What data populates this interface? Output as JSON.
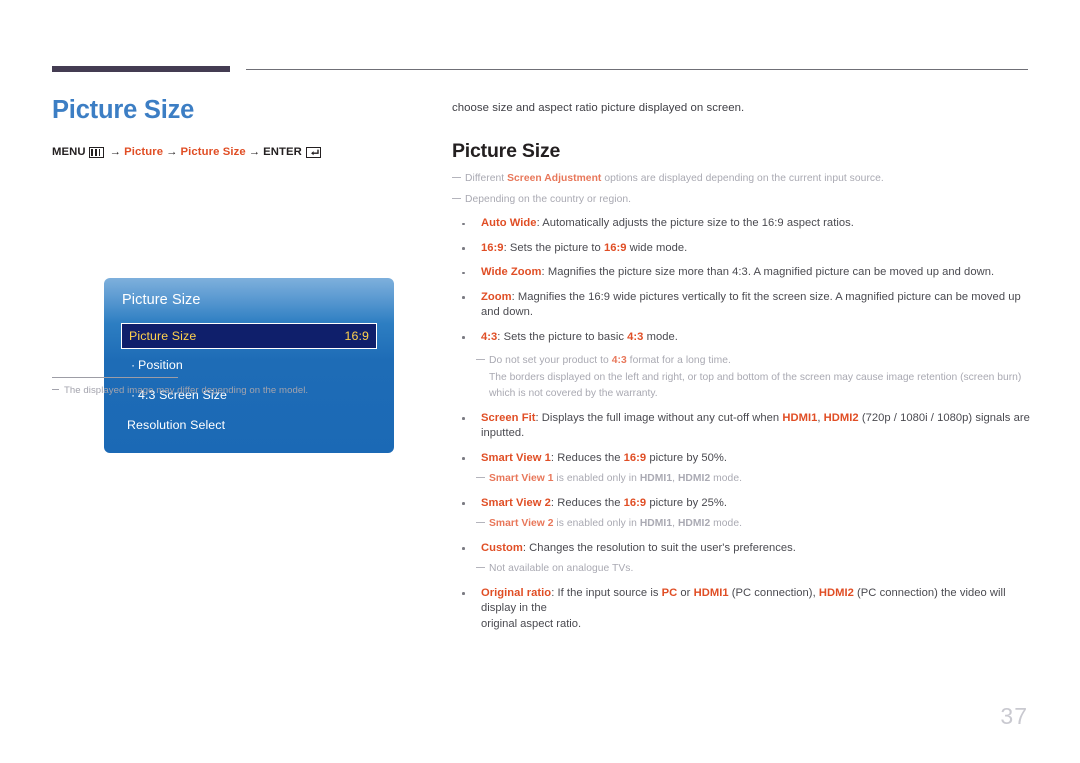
{
  "document": {
    "page_number": "37"
  },
  "left": {
    "title": "Picture Size",
    "menu_path": {
      "menu_label": "MENU",
      "menu_icon": "menu-grid-icon",
      "arrow": "→",
      "step1": "Picture",
      "step2": "Picture Size",
      "enter_label": "ENTER",
      "enter_icon": "enter-return-icon"
    },
    "osd": {
      "title": "Picture Size",
      "selected_row": {
        "label": "Picture Size",
        "value": "16:9"
      },
      "items": [
        {
          "marker": "·",
          "label": "Position"
        },
        {
          "marker": "·",
          "label": "4:3 Screen Size"
        },
        {
          "marker": "",
          "label": "Resolution Select"
        }
      ]
    },
    "footnote": "The displayed image may differ depending on the model."
  },
  "right": {
    "intro": "choose size and aspect ratio picture displayed on screen.",
    "section_title": "Picture Size",
    "notes_top": [
      {
        "pre": "Different ",
        "accent": "Screen Adjustment",
        "post": " options are displayed depending on the current input source."
      },
      {
        "pre": "Depending on the country or region.",
        "accent": "",
        "post": ""
      }
    ],
    "bullets": [
      {
        "term": "Auto Wide",
        "text": ": Automatically adjusts the picture size to the 16:9 aspect ratios."
      },
      {
        "term": "16:9",
        "text": ": Sets the picture to 16:9 wide mode.",
        "inline_accents": [
          "16:9"
        ]
      },
      {
        "term": "Wide Zoom",
        "text": ": Magnifies the picture size more than 4:3. A magnified picture can be moved up and down."
      },
      {
        "term": "Zoom",
        "text": ": Magnifies the 16:9 wide pictures vertically to fit the screen size. A magnified picture can be moved up and down."
      },
      {
        "term": "4:3",
        "text": ": Sets the picture to basic 4:3 mode.",
        "inline_accents": [
          "4:3"
        ]
      }
    ],
    "note_43": {
      "pre": "Do not set your product to ",
      "accent": "4:3",
      "post": " format for a long time.",
      "continuation_1": "The borders displayed on the left and right, or top and bottom of the screen may cause image retention (screen burn)",
      "continuation_2": "which is not covered by the warranty."
    },
    "bullets_2": [
      {
        "term": "Screen Fit",
        "parts": [
          {
            "t": ": Displays the full image without any cut-off when ",
            "style": "plain"
          },
          {
            "t": "HDMI1",
            "style": "accent"
          },
          {
            "t": ", ",
            "style": "plain"
          },
          {
            "t": "HDMI2",
            "style": "accent"
          },
          {
            "t": " (720p / 1080i / 1080p) signals are inputted.",
            "style": "plain"
          }
        ]
      },
      {
        "term": "Smart View 1",
        "parts": [
          {
            "t": ": Reduces the ",
            "style": "plain"
          },
          {
            "t": "16:9",
            "style": "accent"
          },
          {
            "t": " picture by 50%.",
            "style": "plain"
          }
        ]
      }
    ],
    "note_sv1": {
      "accent1": "Smart View 1",
      "mid": " is enabled only in ",
      "accent2": "HDMI1",
      "sep": ", ",
      "accent3": "HDMI2",
      "tail": " mode."
    },
    "bullet_sv2": {
      "term": "Smart View 2",
      "parts": [
        {
          "t": ": Reduces the ",
          "style": "plain"
        },
        {
          "t": "16:9",
          "style": "accent"
        },
        {
          "t": " picture by 25%.",
          "style": "plain"
        }
      ]
    },
    "note_sv2": {
      "accent1": "Smart View 2",
      "mid": " is enabled only in ",
      "accent2": "HDMI1",
      "sep": ", ",
      "accent3": "HDMI2",
      "tail": " mode."
    },
    "bullet_custom": {
      "term": "Custom",
      "text": ": Changes the resolution to suit the user's preferences."
    },
    "note_custom": "Not available on analogue TVs.",
    "bullet_original": {
      "term": "Original ratio",
      "parts": [
        {
          "t": ": If the input source is ",
          "style": "plain"
        },
        {
          "t": "PC",
          "style": "accent"
        },
        {
          "t": " or ",
          "style": "plain"
        },
        {
          "t": "HDMI1",
          "style": "accent"
        },
        {
          "t": " (PC connection), ",
          "style": "plain"
        },
        {
          "t": "HDMI2",
          "style": "accent"
        },
        {
          "t": " (PC connection) the video will display in the",
          "style": "plain"
        }
      ],
      "line2": "original aspect ratio."
    }
  },
  "colors": {
    "accent_orange": "#e04e25",
    "title_blue": "#3c7ec4",
    "rule_dark": "#443c52",
    "osd_blue": "#1b69b5",
    "osd_selected_bg": "#0f1f6b",
    "osd_selected_text": "#ffd24d",
    "note_gray": "#a9a9b2",
    "page_num_gray": "#c9c9d0"
  }
}
